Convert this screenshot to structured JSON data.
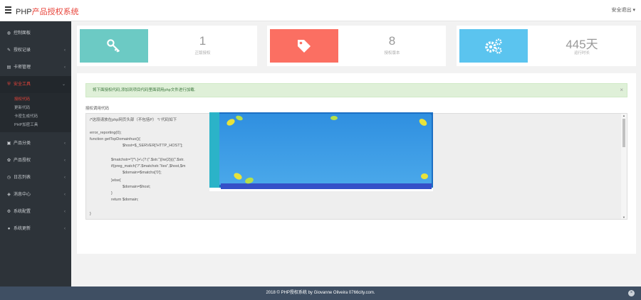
{
  "header": {
    "brand_prefix": "PHP",
    "brand_suffix": "产品授权系统",
    "logout_label": "安全退出",
    "logout_caret": "▾"
  },
  "sidebar": {
    "items": [
      {
        "label": "控制面板",
        "icon": "dashboard-icon",
        "chevron": ""
      },
      {
        "label": "授权记录",
        "icon": "wrench-icon",
        "chevron": "‹"
      },
      {
        "label": "卡密管理",
        "icon": "card-icon",
        "chevron": "‹"
      },
      {
        "label": "安全工具",
        "icon": "shield-icon",
        "chevron": "⌄"
      },
      {
        "label": "产品分类",
        "icon": "folder-icon",
        "chevron": "‹"
      },
      {
        "label": "产品授权",
        "icon": "gear-icon",
        "chevron": "‹"
      },
      {
        "label": "日志列表",
        "icon": "clock-icon",
        "chevron": "‹"
      },
      {
        "label": "消息中心",
        "icon": "bell-icon",
        "chevron": "‹"
      },
      {
        "label": "系统配置",
        "icon": "settings-icon",
        "chevron": "‹"
      },
      {
        "label": "系统更新",
        "icon": "info-icon",
        "chevron": "‹"
      }
    ],
    "security_sub": [
      "授权代码",
      "更新代码",
      "卡密生成代码",
      "PHP加密工具"
    ]
  },
  "stats": [
    {
      "value": "1",
      "label": "正版授权",
      "color": "#6ccac4",
      "icon": "key-icon"
    },
    {
      "value": "8",
      "label": "授权版本",
      "color": "#fb6f62",
      "icon": "tag-icon"
    },
    {
      "value": "445天",
      "label": "运行时长",
      "color": "#5bc4ef",
      "icon": "gears-icon"
    }
  ],
  "panel": {
    "alert_text": "将下面授权代码,添加到项目代码里面调用php文件进行加载.",
    "alert_close": "×",
    "code_label": "授权调用代码",
    "code_lines": [
      "/*这段请放在php网页头部（不包括P） */ 代码如下",
      "",
      "error_reporting(0);",
      "function getTopDomainhuo(){",
      "$host=$_SERVER['HTTP_HOST'];",
      "",
      "$matchstr=\"[^\\.]+\\.(?:(\".$str.\")|\\w{2}|((\".$str.",
      "if(preg_match(\"/\".$matchstr.\"/ies\",$host,$m",
      "$domain=$matchs['0'];",
      "}else{",
      "$domain=$host;",
      "}",
      "return $domain;",
      "",
      "}"
    ]
  },
  "footer": {
    "text": "2018 © PHP授权系统 by Giovanne Oliveira 0766city.com.",
    "close": "×"
  },
  "colors": {
    "sidebar_bg": "#2d3339",
    "accent_red": "#e8443a",
    "footer_bg": "#3f4f63",
    "alert_bg": "#dff0d8"
  }
}
